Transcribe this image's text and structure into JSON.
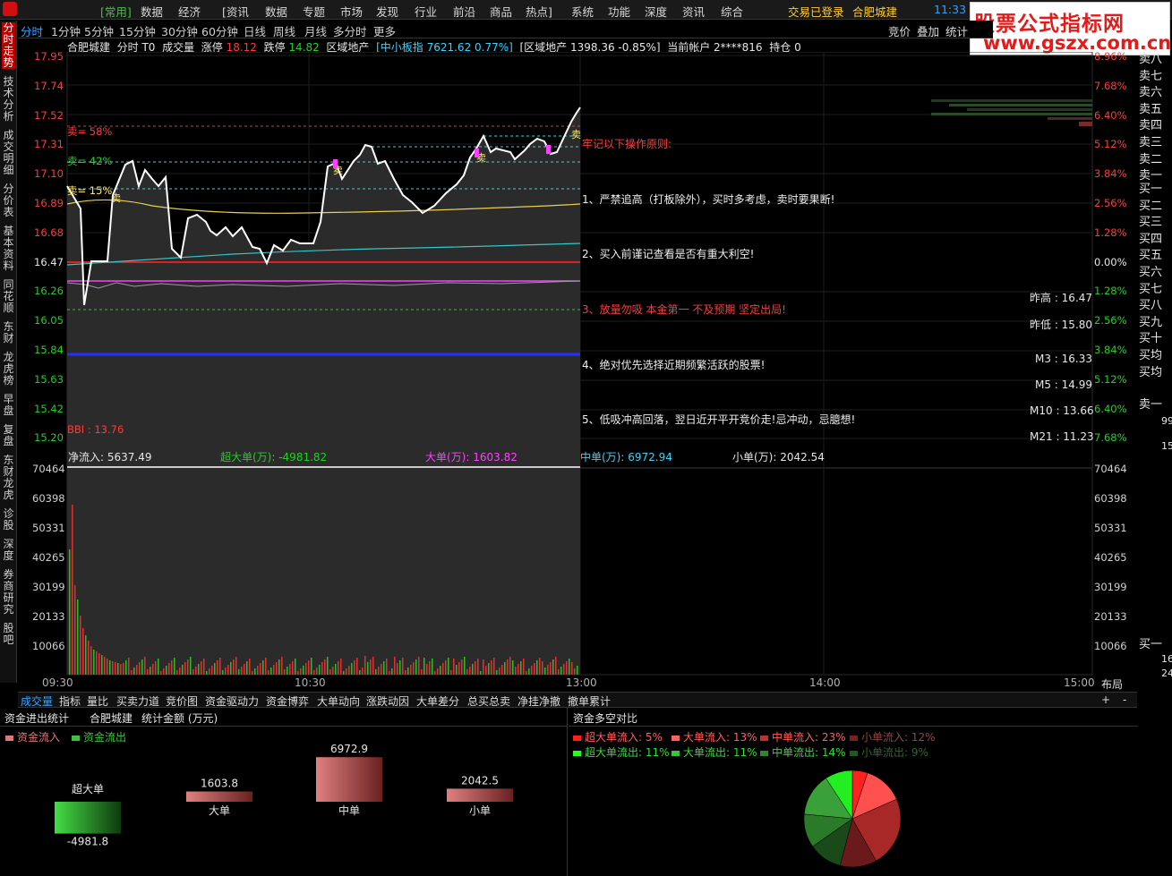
{
  "menu": {
    "items": [
      "[常用]",
      "数据",
      "经济",
      "[资讯",
      "数据",
      "专题",
      "市场",
      "发现",
      "行业",
      "前沿",
      "商品",
      "热点]",
      "系统",
      "功能",
      "深度",
      "资讯",
      "综合"
    ],
    "login_status": "交易已登录",
    "stock_name": "合肥城建",
    "clock": "11:33"
  },
  "watermark": {
    "line1": "股票公式指标网",
    "line2": "www.gszx.com.cn"
  },
  "period_tabs": [
    "分时",
    "1分钟",
    "5分钟",
    "15分钟",
    "30分钟",
    "60分钟",
    "日线",
    "周线",
    "月线",
    "多分时",
    "更多"
  ],
  "right_tabs": [
    "竞价",
    "叠加",
    "统计"
  ],
  "left_nav": [
    "分时走势",
    "技术分析",
    "成交明细",
    "分价表",
    "基本资料",
    "同花顺",
    "东财",
    "龙虎榜",
    "早盘",
    "复盘",
    "东财龙虎",
    "诊股",
    "深度",
    "券商研究",
    "股吧"
  ],
  "info_bar": {
    "name": "合肥城建",
    "mode": "分时 T0",
    "vol_label": "成交量",
    "limit_up_label": "涨停",
    "limit_up": "18.12",
    "limit_down_label": "跌停",
    "limit_down": "14.82",
    "sector": "区域地产",
    "index_text": "[中小板指 7621.62 0.77%]",
    "sector_text": "[区域地产 1398.36 -0.85%]",
    "account_label": "当前帐户",
    "account": "2****816",
    "position_label": "持仓",
    "position": "0"
  },
  "price_axis": {
    "left": [
      "17.95",
      "17.74",
      "17.52",
      "17.31",
      "17.10",
      "16.89",
      "16.68",
      "16.47",
      "16.26",
      "16.05",
      "15.84",
      "15.63",
      "15.42",
      "15.20"
    ]
  },
  "pct_axis": {
    "right": [
      "8.96%",
      "7.68%",
      "6.40%",
      "5.12%",
      "3.84%",
      "2.56%",
      "1.28%",
      "0.00%",
      "1.28%",
      "2.56%",
      "3.84%",
      "5.12%",
      "6.40%",
      "7.68%"
    ]
  },
  "chart_marks": {
    "sell58": "卖= 58%",
    "sell42": "卖= 42%",
    "sell15": "卖= 15%",
    "mai": "卖",
    "bbi": "BBI : 13.76"
  },
  "notices": {
    "title": "牢记以下操作原则:",
    "n1": "1、严禁追高（打板除外），买时多考虑，卖时要果断!",
    "n2": "2、买入前谨记查看是否有重大利空!",
    "n3": "3、放量勿吸  本金第一  不及预期  坚定出局!",
    "n4": "4、绝对优先选择近期频繁活跃的股票!",
    "n5": "5、低吸冲高回落，翌日近开平开竞价走!忌冲动，忌臆想!"
  },
  "side_stats": {
    "prev_high": "昨高 : 16.47",
    "prev_low": "昨低 : 15.80",
    "m3": "M3 : 16.33",
    "m5": "M5 : 14.99",
    "m10": "M10 : 13.66",
    "m21": "M21 : 11.23"
  },
  "flow_bar": {
    "net": "净流入: 5637.49",
    "super": "超大单(万): -4981.82",
    "large": "大单(万): 1603.82",
    "medium": "中单(万): 6972.94",
    "small": "小单(万): 2042.54"
  },
  "vol_axis": [
    "70464",
    "60398",
    "50331",
    "40265",
    "30199",
    "20133",
    "10066"
  ],
  "time_axis": [
    "09:30",
    "10:30",
    "13:00",
    "14:00",
    "15:00"
  ],
  "layout_label": "布局",
  "orderbook": {
    "sells": [
      "卖八",
      "卖七",
      "卖六",
      "卖五",
      "卖四",
      "卖三",
      "卖二",
      "卖一"
    ],
    "buys": [
      "买一",
      "买二",
      "买三",
      "买四",
      "买五",
      "买六",
      "买七",
      "买八",
      "买九",
      "买十",
      "买均",
      "买均"
    ],
    "sell_one": "卖一",
    "buy_one": "买一",
    "n1": "99",
    "n2": "15",
    "n3": "16",
    "n4": "24"
  },
  "bottom_tabs": [
    "成交量",
    "指标",
    "量比",
    "买卖力道",
    "竞价图",
    "资金驱动力",
    "资金博弈",
    "大单动向",
    "涨跌动因",
    "大单差分",
    "总买总卖",
    "净挂净撤",
    "撤单累计"
  ],
  "bottom_plus": "+",
  "bottom_minus": "-",
  "flow_panel": {
    "title": "资金进出统计",
    "stock": "合肥城建",
    "unit": "统计金额 (万元)",
    "legend_in": "资金流入",
    "legend_out": "资金流出",
    "colors": {
      "in": "#d87a7a",
      "out": "#3fc13f"
    },
    "bars": [
      {
        "label": "超大单",
        "value": -4981.8,
        "text": "-4981.8"
      },
      {
        "label": "大单",
        "value": 1603.8,
        "text": "1603.8"
      },
      {
        "label": "中单",
        "value": 6972.9,
        "text": "6972.9"
      },
      {
        "label": "小单",
        "value": 2042.5,
        "text": "2042.5"
      }
    ]
  },
  "pie_panel": {
    "title": "资金多空对比",
    "legend": [
      {
        "label": "超大单流入: 5%",
        "color": "#ff2020"
      },
      {
        "label": "大单流入: 13%",
        "color": "#ff6060"
      },
      {
        "label": "中单流入: 23%",
        "color": "#c03030"
      },
      {
        "label": "小单流入: 12%",
        "color": "#7a2020"
      },
      {
        "label": "超大单流出: 11%",
        "color": "#22ff22"
      },
      {
        "label": "大单流出: 11%",
        "color": "#40c040"
      },
      {
        "label": "中单流出: 14%",
        "color": "#2a8a2a"
      },
      {
        "label": "小单流出: 9%",
        "color": "#1e5a1e"
      }
    ]
  },
  "chart_data": [
    {
      "type": "pie",
      "title": "资金多空对比",
      "categories": [
        "超大单流入",
        "大单流入",
        "中单流入",
        "小单流入",
        "超大单流出",
        "大单流出",
        "中单流出",
        "小单流出"
      ],
      "values": [
        5,
        13,
        23,
        12,
        11,
        11,
        14,
        9
      ],
      "colors": [
        "#ff2020",
        "#ff5050",
        "#a82828",
        "#6a1a1a",
        "#1a4a1a",
        "#2a7a2a",
        "#3aa03a",
        "#22ee22"
      ]
    },
    {
      "type": "bar",
      "title": "资金进出统计",
      "categories": [
        "超大单",
        "大单",
        "中单",
        "小单"
      ],
      "values": [
        -4981.8,
        1603.8,
        6972.9,
        2042.5
      ]
    }
  ]
}
